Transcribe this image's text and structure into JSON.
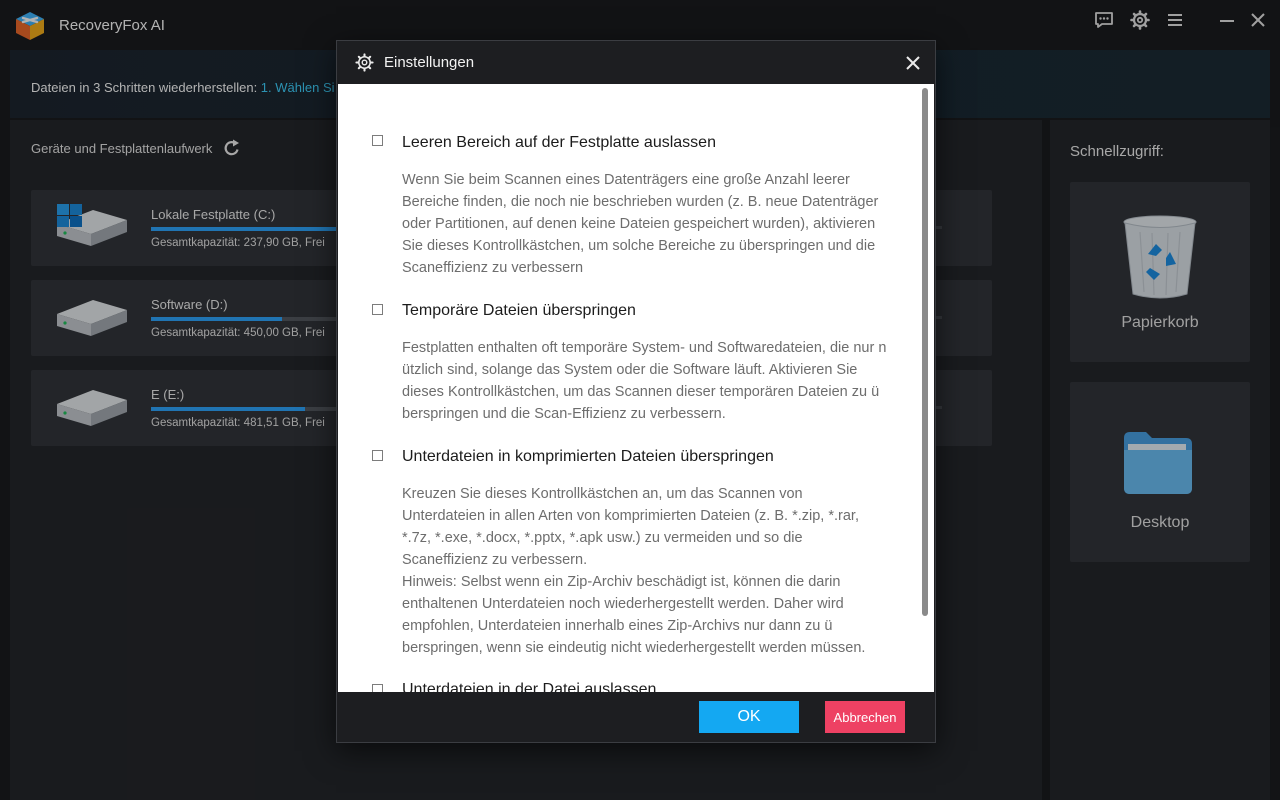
{
  "app": {
    "title": "RecoveryFox AI",
    "buttons": [
      "feedback-icon",
      "settings-icon",
      "menu-icon",
      "minimize-icon",
      "close-icon"
    ]
  },
  "stepbar": {
    "prefix": "Dateien in 3 Schritten wiederherstellen: ",
    "step1": "1. Wählen Si"
  },
  "devices": {
    "title": "Geräte und Festplattenlaufwerk",
    "items": [
      {
        "name": "Lokale Festplatte (C:)",
        "capacity": "Gesamtkapazität: 237,90 GB, Frei",
        "used_fraction": 0.9,
        "icon": "windows-drive-icon"
      },
      {
        "name": "Software (D:)",
        "capacity": "Gesamtkapazität: 450,00 GB, Frei",
        "used_fraction": 0.57,
        "icon": "hard-drive-icon"
      },
      {
        "name": "E (E:)",
        "capacity": "Gesamtkapazität: 481,51 GB, Frei",
        "used_fraction": 0.67,
        "icon": "hard-drive-icon"
      }
    ]
  },
  "quick_access": {
    "title": "Schnellzugriff:",
    "items": [
      {
        "label": "Papierkorb",
        "icon": "recycle-bin-icon"
      },
      {
        "label": "Desktop",
        "icon": "folder-icon"
      }
    ]
  },
  "dialog": {
    "title": "Einstellungen",
    "options": [
      {
        "title": "Leeren Bereich auf der Festplatte auslassen",
        "checked": false,
        "description": "Wenn Sie beim Scannen eines Datenträgers eine große Anzahl leerer\nBereiche finden, die noch nie beschrieben wurden (z. B. neue Datenträger\noder Partitionen, auf denen keine Dateien gespeichert wurden), aktivieren\nSie dieses Kontrollkästchen, um solche Bereiche zu überspringen und die\nScaneffizienz zu verbessern"
      },
      {
        "title": "Temporäre Dateien überspringen",
        "checked": false,
        "description": "Festplatten enthalten oft temporäre System- und Softwaredateien, die nur n\nützlich sind, solange das System oder die Software läuft. Aktivieren Sie\ndieses Kontrollkästchen, um das Scannen dieser temporären Dateien zu ü\nberspringen und die Scan-Effizienz zu verbessern."
      },
      {
        "title": "Unterdateien in komprimierten Dateien überspringen",
        "checked": false,
        "description": "Kreuzen Sie dieses Kontrollkästchen an, um das Scannen von\nUnterdateien in allen Arten von komprimierten Dateien (z. B. *.zip, *.rar,\n*.7z, *.exe, *.docx, *.pptx, *.apk usw.) zu vermeiden und so die\nScaneffizienz zu verbessern.\nHinweis: Selbst wenn ein Zip-Archiv beschädigt ist, können die darin\nenthaltenen Unterdateien noch wiederhergestellt werden. Daher wird\nempfohlen, Unterdateien innerhalb eines Zip-Archivs nur dann zu ü\nberspringen, wenn sie eindeutig nicht wiederhergestellt werden müssen."
      },
      {
        "title": "Unterdateien in der Datei auslassen",
        "checked": false,
        "description": ""
      }
    ],
    "ok_label": "OK",
    "cancel_label": "Abbrechen"
  },
  "colors": {
    "accent": "#3fd2ff",
    "progress": "#2ea7ff",
    "ok_button": "#14a8f2",
    "cancel_button": "#ee4163"
  }
}
